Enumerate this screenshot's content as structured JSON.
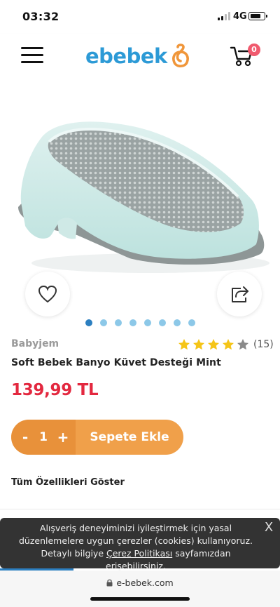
{
  "status_bar": {
    "time": "03:32",
    "network": "4G"
  },
  "header": {
    "menu_icon": "hamburger-menu-icon",
    "logo_text": "ebebek",
    "cart_icon": "stroller-cart-icon",
    "cart_count": "0"
  },
  "product": {
    "image_alt": "baby-bath-seat",
    "favorite_icon": "heart-icon",
    "share_icon": "share-icon",
    "carousel": {
      "total": 8,
      "active_index": 0
    },
    "brand": "Babyjem",
    "rating": {
      "value": 4,
      "max": 5,
      "count": "(15)"
    },
    "title": "Soft Bebek Banyo Küvet Desteği Mint",
    "price": "139,99 TL"
  },
  "cart_bar": {
    "minus_label": "-",
    "quantity": "1",
    "plus_label": "+",
    "add_label": "Sepete Ekle"
  },
  "features_link": "Tüm Özellikleri Göster",
  "cookie": {
    "text_1": "Alışveriş deneyiminizi iyileştirmek için yasal düzenlemelere uygun çerezler (cookies) kullanıyoruz. Detaylı bilgiye ",
    "link_text": "Çerez Politikası",
    "text_2": " sayfamızdan erişebilirsiniz.",
    "close_label": "X"
  },
  "browser": {
    "url": "e-bebek.com"
  },
  "colors": {
    "brand_blue": "#2c9ad6",
    "brand_orange": "#f0a04a",
    "price_red": "#e3283f",
    "star_gold": "#f5c518",
    "badge_pink": "#f05a6e"
  }
}
